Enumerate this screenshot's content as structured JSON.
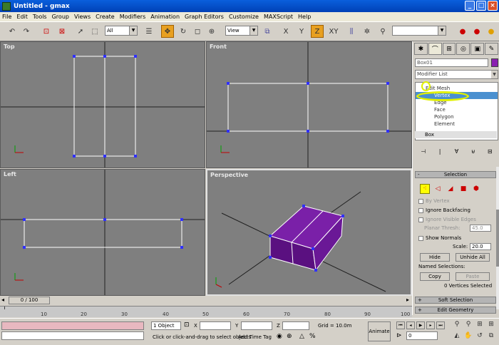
{
  "window": {
    "title": "Untitled - gmax",
    "min": "_",
    "max": "□",
    "close": "×"
  },
  "menu": [
    "File",
    "Edit",
    "Tools",
    "Group",
    "Views",
    "Create",
    "Modifiers",
    "Animation",
    "Graph Editors",
    "Customize",
    "MAXScript",
    "Help"
  ],
  "toolbar": {
    "filter_select": "All",
    "refcoord_select": "View",
    "xy_label": "XY",
    "x_label": "X",
    "y_label": "Y",
    "z_label": "Z"
  },
  "viewports": {
    "top": "Top",
    "front": "Front",
    "left": "Left",
    "perspective": "Perspective"
  },
  "command_panel": {
    "object_name": "Box01",
    "object_color": "#8a20b0",
    "modifier_list": "Modifier List",
    "stack": {
      "edit_mesh": "Edit Mesh",
      "vertex": "Vertex",
      "edge": "Edge",
      "face": "Face",
      "polygon": "Polygon",
      "element": "Element",
      "box": "Box"
    },
    "selection_rollout": "Selection",
    "by_vertex": "By Vertex",
    "ignore_backfacing": "Ignore Backfacing",
    "ignore_visible_edges": "Ignore Visible Edges",
    "planar_thresh_label": "Planar Thresh:",
    "planar_thresh_value": "45.0",
    "show_normals": "Show Normals",
    "scale_label": "Scale:",
    "scale_value": "20.0",
    "hide": "Hide",
    "unhide_all": "Unhide All",
    "named_selections": "Named Selections:",
    "copy": "Copy",
    "paste": "Paste",
    "vertices_selected": "0 Vertices Selected",
    "soft_selection": "Soft Selection",
    "edit_geometry": "Edit Geometry"
  },
  "timeline": {
    "slider": "0 / 100",
    "ticks": [
      "10",
      "20",
      "30",
      "40",
      "50",
      "60",
      "70",
      "80",
      "90",
      "100"
    ]
  },
  "status": {
    "selected": "1 Object",
    "x_label": "X",
    "y_label": "Y",
    "z_label": "Z",
    "grid": "Grid = 10.0m",
    "prompt": "Click or click-and-drag to select objects",
    "add_time_tag": "Add Time Tag",
    "animate": "Animate",
    "frame": "0"
  }
}
